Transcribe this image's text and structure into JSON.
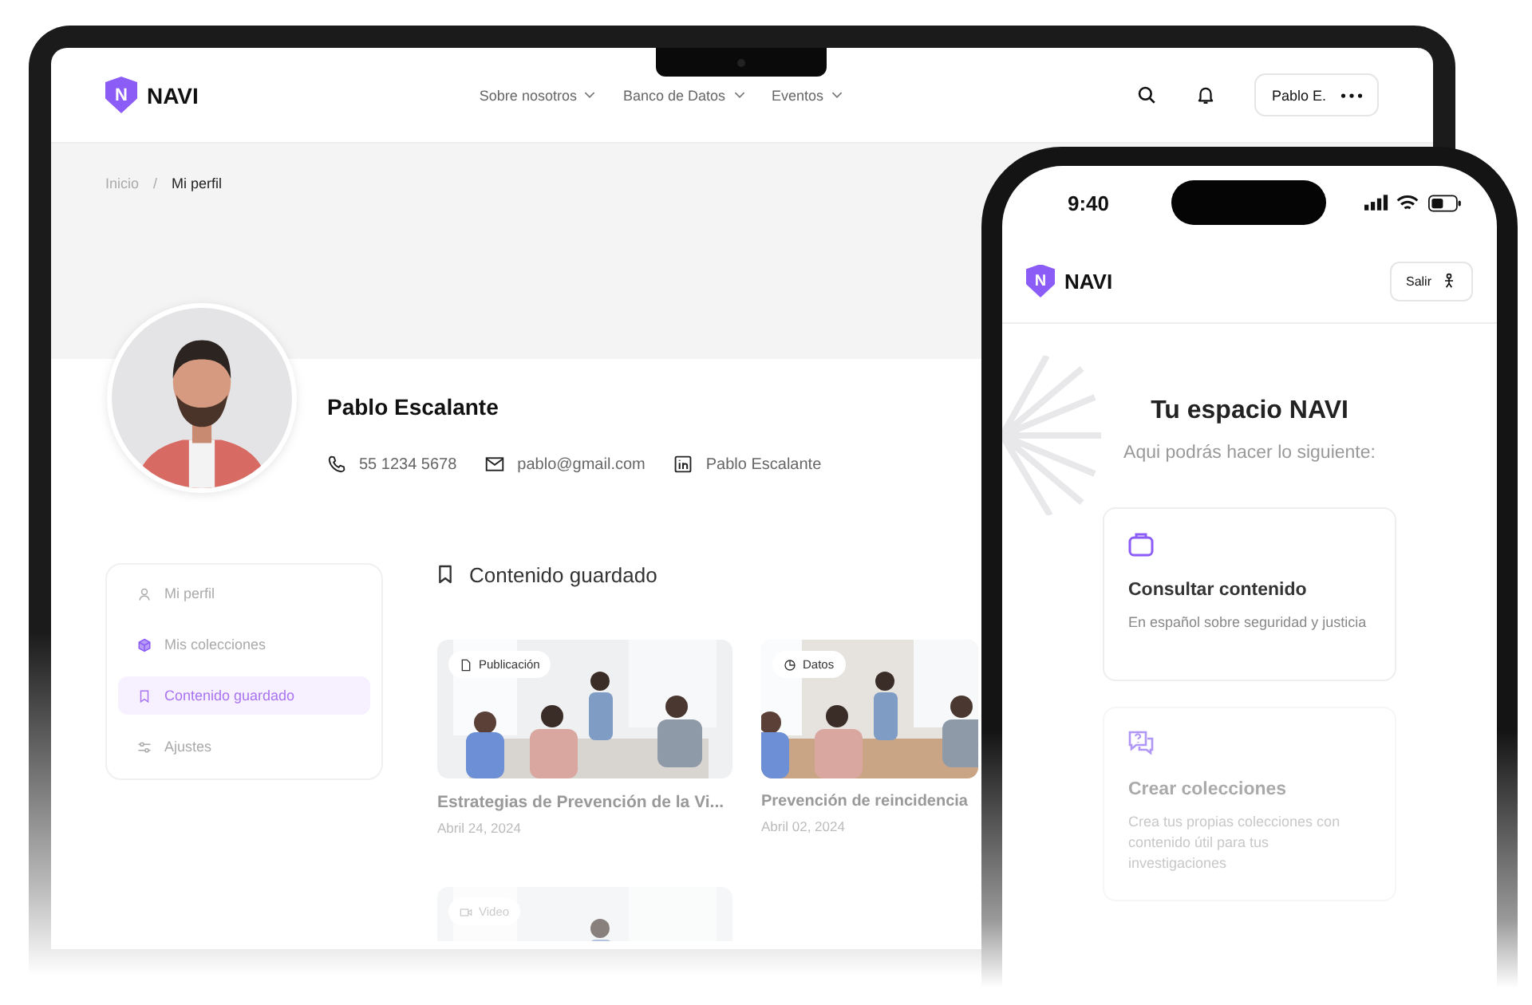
{
  "laptop": {
    "header": {
      "logo_mark": "N",
      "logo": "NAVI",
      "nav": [
        {
          "label": "Sobre nosotros"
        },
        {
          "label": "Banco de Datos"
        },
        {
          "label": "Eventos"
        }
      ],
      "user_button": "Pablo E."
    },
    "breadcrumb": [
      {
        "label": "Inicio",
        "current": false
      },
      {
        "label": "/",
        "current": false
      },
      {
        "label": "Mi perfil",
        "current": true
      }
    ],
    "profile": {
      "name": "Pablo Escalante",
      "contacts": [
        {
          "kind": "phone",
          "text": "55 1234 5678"
        },
        {
          "kind": "email",
          "text": "pablo@gmail.com"
        },
        {
          "kind": "linkedin",
          "text": "Pablo Escalante"
        }
      ]
    },
    "sidebar": {
      "items": [
        {
          "kind": "user",
          "label": "Mi perfil",
          "selected": false
        },
        {
          "kind": "cube",
          "label": "Mis colecciones",
          "selected": false
        },
        {
          "kind": "bookmark",
          "label": "Contenido guardado",
          "selected": true
        },
        {
          "kind": "sliders",
          "label": "Ajustes",
          "selected": false
        }
      ]
    },
    "saved": {
      "title": "Contenido guardado",
      "cards": [
        {
          "kind": "document",
          "tag": "Publicación",
          "title": "Estrategias de Prevención de la Vi...",
          "date": "Abril 24, 2024"
        },
        {
          "kind": "chart",
          "tag": "Datos",
          "title": "Prevención de reincidencia",
          "date": "Abril 02, 2024"
        },
        {
          "kind": "video",
          "tag": "Video"
        }
      ]
    }
  },
  "phone": {
    "status": {
      "time": "9:40"
    },
    "header": {
      "logo_mark": "N",
      "logo": "NAVI",
      "button": "Salir"
    },
    "intro": {
      "title": "Tu espacio NAVI",
      "subtitle": "Aqui podrás hacer lo siguiente:"
    },
    "features": [
      {
        "kind": "bag",
        "title": "Consultar contenido",
        "description": "En español sobre seguridad y justicia"
      },
      {
        "kind": "chat",
        "title": "Crear colecciones",
        "description": "Crea tus propias colecciones con contenido útil para tus investigaciones"
      }
    ]
  }
}
